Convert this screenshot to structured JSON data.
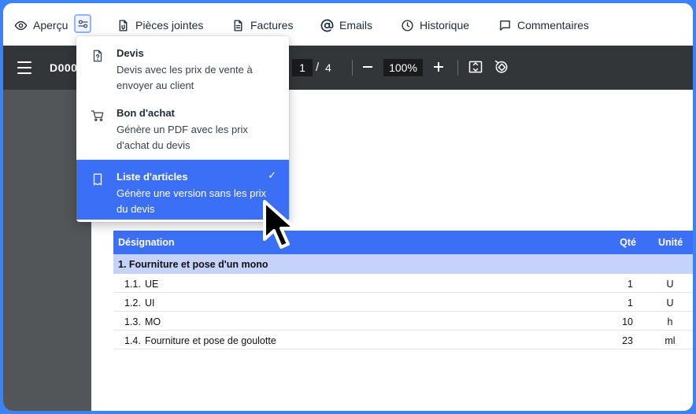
{
  "tabs": [
    {
      "label": "Aperçu",
      "icon": "eye-icon"
    },
    {
      "label": "Pièces jointes",
      "icon": "paperclip-file-icon"
    },
    {
      "label": "Factures",
      "icon": "invoice-icon"
    },
    {
      "label": "Emails",
      "icon": "at-icon"
    },
    {
      "label": "Historique",
      "icon": "clock-icon"
    },
    {
      "label": "Commentaires",
      "icon": "comment-icon"
    }
  ],
  "settings_icon": "settings-toggle-icon",
  "viewer": {
    "doc_title": "D000",
    "page_current": "1",
    "page_sep": "/",
    "page_total": "4",
    "zoom": "100%"
  },
  "dropdown": {
    "items": [
      {
        "title": "Devis",
        "desc": "Devis avec les prix de vente à envoyer au client",
        "icon": "quote-doc-icon"
      },
      {
        "title": "Bon d'achat",
        "desc": "Génère un PDF avec les prix d'achat du devis",
        "icon": "cart-icon"
      },
      {
        "title": "Liste d'articles",
        "desc": "Génère une version sans les prix du devis",
        "icon": "receipt-icon",
        "selected": true
      }
    ],
    "check": "✓"
  },
  "table": {
    "headers": {
      "designation": "Désignation",
      "qte": "Qté",
      "unite": "Unité"
    },
    "section": "1.  Fourniture et pose d'un mono",
    "rows": [
      {
        "num": "1.1.",
        "designation": "UE",
        "qte": "1",
        "unite": "U"
      },
      {
        "num": "1.2.",
        "designation": "UI",
        "qte": "1",
        "unite": "U"
      },
      {
        "num": "1.3.",
        "designation": "MO",
        "qte": "10",
        "unite": "h"
      },
      {
        "num": "1.4.",
        "designation": "Fourniture et pose de goulotte",
        "qte": "23",
        "unite": "ml"
      }
    ]
  },
  "colors": {
    "accent": "#3b6ff5",
    "section_bg": "#c5d3fb",
    "toolbar": "#323639",
    "frame": "#3b82f6"
  }
}
